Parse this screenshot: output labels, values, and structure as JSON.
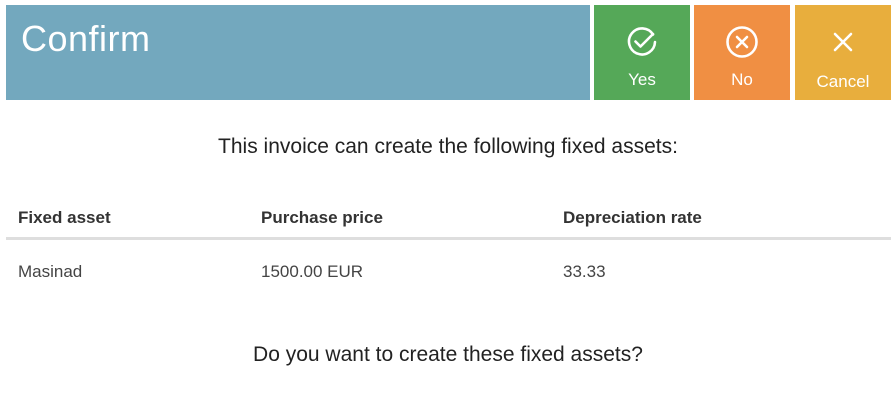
{
  "dialog": {
    "title": "Confirm",
    "buttons": {
      "yes": {
        "label": "Yes",
        "icon": "check-circle-icon",
        "color": "#55a858"
      },
      "no": {
        "label": "No",
        "icon": "x-circle-icon",
        "color": "#f08f43"
      },
      "cancel": {
        "label": "Cancel",
        "icon": "close-icon",
        "color": "#e8ae3d"
      }
    },
    "header_color": "#73a8be"
  },
  "body": {
    "intro": "This invoice can create the following fixed assets:",
    "question": "Do you want to create these fixed assets?"
  },
  "table": {
    "columns": [
      "Fixed asset",
      "Purchase price",
      "Depreciation rate"
    ],
    "rows": [
      [
        "Masinad",
        "1500.00 EUR",
        "33.33"
      ]
    ]
  }
}
